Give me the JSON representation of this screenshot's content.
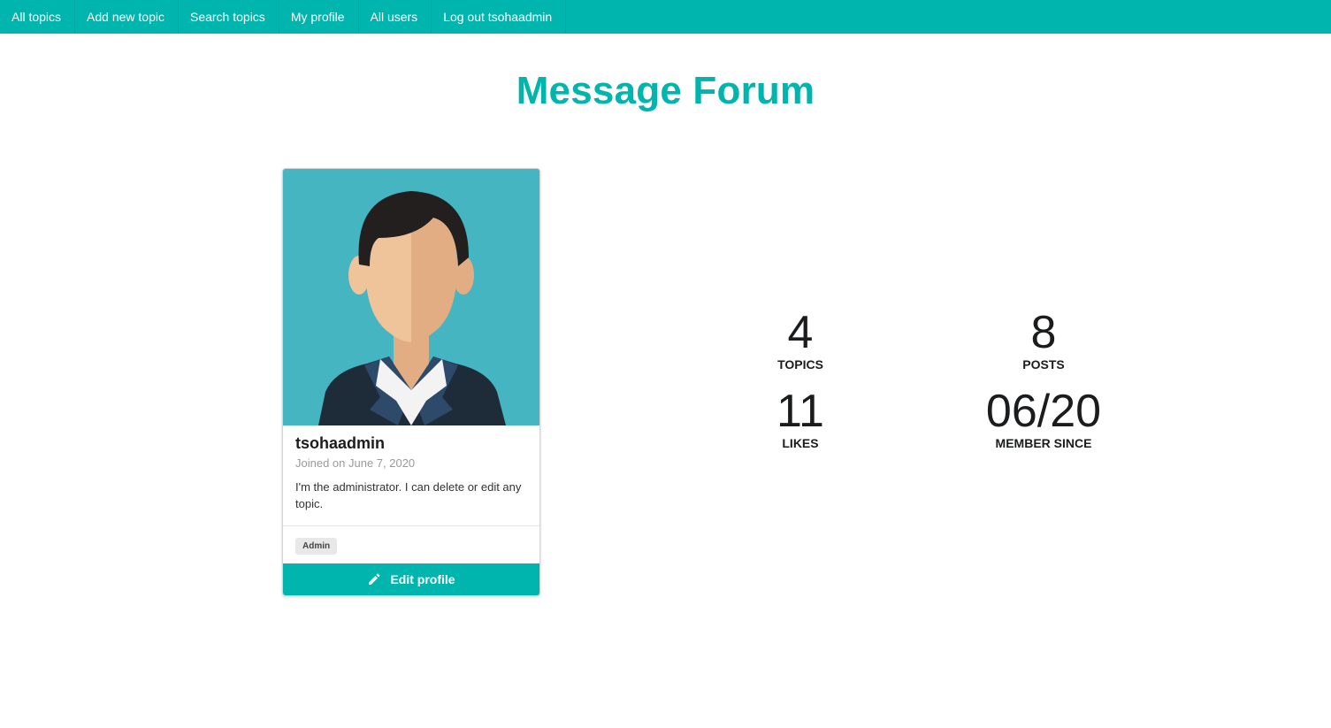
{
  "nav": {
    "items": [
      {
        "label": "All topics"
      },
      {
        "label": "Add new topic"
      },
      {
        "label": "Search topics"
      },
      {
        "label": "My profile"
      },
      {
        "label": "All users"
      },
      {
        "label": "Log out tsohaadmin"
      }
    ]
  },
  "page": {
    "title": "Message Forum"
  },
  "profile": {
    "username": "tsohaadmin",
    "joined": "Joined on June 7, 2020",
    "bio": "I'm the administrator. I can delete or edit any topic.",
    "badge": "Admin",
    "edit_label": "Edit profile",
    "avatar_icon": "user-avatar-illustration"
  },
  "stats": {
    "topics": {
      "value": "4",
      "label": "TOPICS"
    },
    "posts": {
      "value": "8",
      "label": "POSTS"
    },
    "likes": {
      "value": "11",
      "label": "LIKES"
    },
    "member_since": {
      "value": "06/20",
      "label": "MEMBER SINCE"
    }
  },
  "colors": {
    "accent": "#00b5ad",
    "avatar_bg": "#45b5c1"
  }
}
